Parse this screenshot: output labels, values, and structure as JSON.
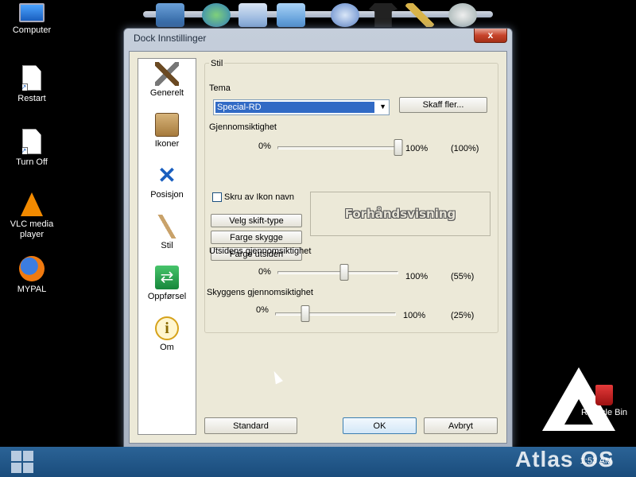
{
  "desktop": {
    "icons": [
      {
        "label": "Computer",
        "icon": "computer-icon"
      },
      {
        "label": "Restart",
        "icon": "restart-shortcut-icon"
      },
      {
        "label": "Turn Off",
        "icon": "turn-off-shortcut-icon"
      },
      {
        "label": "VLC media player",
        "icon": "vlc-icon"
      },
      {
        "label": "MYPAL",
        "icon": "mypal-browser-icon"
      }
    ],
    "recycle_bin": {
      "label": "Recycle Bin",
      "icon": "recycle-bin-icon"
    },
    "brand": "Atlas OS"
  },
  "dock": {
    "items": [
      "desktop-icon",
      "app-icon",
      "documents-icon",
      "photos-icon",
      "globe-icon",
      "shirt-icon",
      "tools-icon",
      "settings-icon"
    ]
  },
  "dialog": {
    "title": "Dock Innstillinger",
    "close_label": "x",
    "sidebar": [
      {
        "label": "Generelt",
        "icon": "hammer-icon"
      },
      {
        "label": "Ikoner",
        "icon": "icons-box-icon"
      },
      {
        "label": "Posisjon",
        "icon": "position-arrows-icon"
      },
      {
        "label": "Stil",
        "icon": "brush-icon"
      },
      {
        "label": "Oppførsel",
        "icon": "behavior-icon"
      },
      {
        "label": "Om",
        "icon": "info-icon"
      }
    ],
    "group_title": "Stil",
    "theme": {
      "label": "Tema",
      "value": "Special-RD",
      "more_button": "Skaff fler..."
    },
    "transparency": {
      "label": "Gjennomsiktighet",
      "min": "0%",
      "max": "100%",
      "value_text": "(100%)",
      "value": 1.0
    },
    "disable_icon_names": {
      "label": "Skru av Ikon navn",
      "checked": false
    },
    "buttons": {
      "font_type": "Velg skift-type",
      "shadow_color": "Farge skygge",
      "outline_color": "Farge utsiden"
    },
    "preview_text": "Forhåndsvisning",
    "outline_transparency": {
      "label": "Utsidens gjennomsiktighet",
      "min": "0%",
      "max": "100%",
      "value_text": "(55%)",
      "value": 0.55
    },
    "shadow_transparency": {
      "label": "Skyggens gjennomsiktighet",
      "min": "0%",
      "max": "100%",
      "value_text": "(25%)",
      "value": 0.25
    },
    "footer": {
      "standard": "Standard",
      "ok": "OK",
      "cancel": "Avbryt"
    }
  },
  "taskbar": {
    "clock": "1:53 AM"
  }
}
